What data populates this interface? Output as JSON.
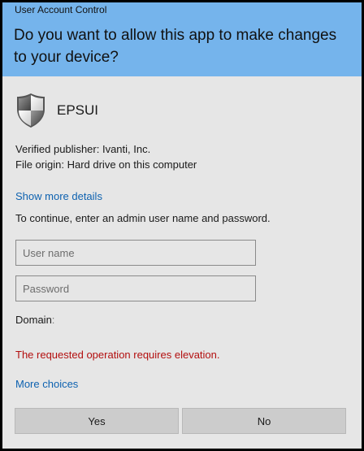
{
  "window": {
    "title": "User Account Control",
    "question": "Do you want to allow this app to make changes to your device?"
  },
  "app": {
    "name": "EPSUI",
    "icon": "uac-shield-icon"
  },
  "details": {
    "publisher": "Verified publisher: Ivanti, Inc.",
    "origin": "File origin: Hard drive on this computer",
    "show_more": "Show more details"
  },
  "credentials": {
    "instruction": "To continue, enter an admin user name and password.",
    "username_placeholder": "User name",
    "username_value": "",
    "password_placeholder": "Password",
    "password_value": "",
    "domain_label": "Domain",
    "domain_suffix": ":"
  },
  "status": {
    "error": "The requested operation requires elevation."
  },
  "more_choices": "More choices",
  "buttons": {
    "yes": "Yes",
    "no": "No"
  },
  "colors": {
    "header": "#75b4ec",
    "body": "#e6e6e6",
    "link": "#0e62b0",
    "error": "#b30f0f",
    "button": "#cccccc"
  }
}
